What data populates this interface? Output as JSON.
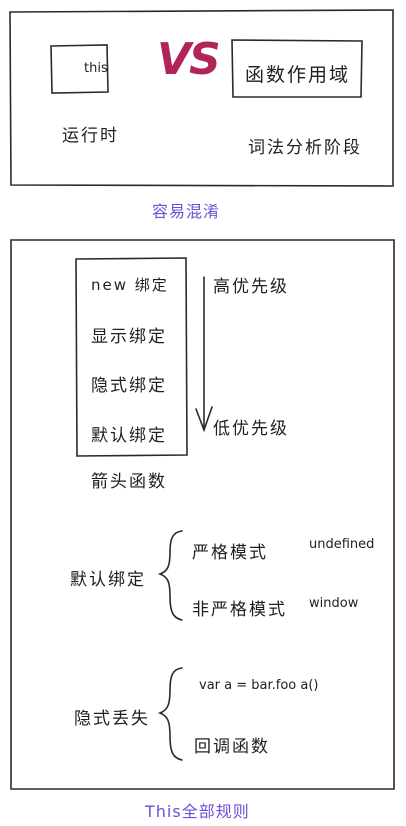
{
  "panel1": {
    "left_box": "this",
    "vs": "VS",
    "right_box": "函数作用域",
    "left_label": "运行时",
    "right_label": "词法分析阶段",
    "caption": "容易混淆"
  },
  "panel2": {
    "binding_list": [
      "new 绑定",
      "显示绑定",
      "隐式绑定",
      "默认绑定"
    ],
    "high_priority": "高优先级",
    "low_priority": "低优先级",
    "arrow_function": "箭头函数",
    "default_binding": {
      "label": "默认绑定",
      "strict": "严格模式",
      "strict_value": "undefined",
      "non_strict": "非严格模式",
      "non_strict_value": "window"
    },
    "implicit_loss": {
      "label": "隐式丢失",
      "case1": "var a = bar.foo  a()",
      "case2": "回调函数"
    },
    "caption": "This全部规则"
  },
  "colors": {
    "ink": "#222222",
    "accent": "#6f4fd8",
    "vs": "#b0245a"
  }
}
